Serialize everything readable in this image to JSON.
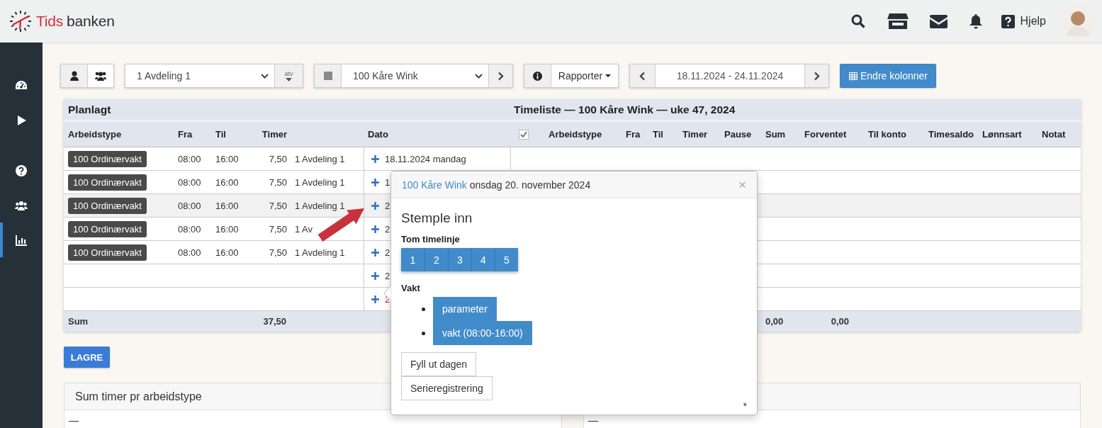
{
  "header": {
    "logo": {
      "brand_red": "Tids",
      "brand_dark": "banken"
    },
    "help": "Hjelp"
  },
  "sidebar": {
    "items": [
      {
        "selected": false
      },
      {
        "selected": false
      },
      {
        "selected": false
      },
      {
        "selected": false
      },
      {
        "selected": true
      }
    ]
  },
  "toolbar": {
    "view_toggle": [
      {
        "selected": true
      },
      {
        "selected": false
      }
    ],
    "department": {
      "value": "1 Avdeling 1"
    },
    "atv": "atv",
    "employee": {
      "value": "100 Kåre Wink"
    },
    "reports": "Rapporter",
    "date_range": "18.11.2024 - 24.11.2024",
    "columns_button": "Endre kolonner"
  },
  "table": {
    "planned_title": "Planlagt",
    "timesheet_title": "Timeliste — 100 Kåre Wink — uke 47, 2024",
    "planned_columns": [
      "Arbeidstype",
      "Fra",
      "Til",
      "Timer"
    ],
    "date_column": "Dato",
    "timesheet_select_all": {
      "checked": true
    },
    "timesheet_columns": [
      "Arbeidstype",
      "Fra",
      "Til",
      "Timer",
      "Pause",
      "Sum",
      "Forventet",
      "Til konto",
      "Timesaldo",
      "Lønnsart",
      "Notat"
    ],
    "rows": [
      {
        "arbeidstype": "100 Ordinærvakt",
        "fra": "08:00",
        "til": "16:00",
        "timer": "7,50",
        "avdeling": "1 Avdeling 1",
        "dato": "18.11.2024 mandag",
        "highlighted": false,
        "weekend": false
      },
      {
        "arbeidstype": "100 Ordinærvakt",
        "fra": "08:00",
        "til": "16:00",
        "timer": "7,50",
        "avdeling": "1 Avdeling 1",
        "dato": "1",
        "highlighted": false,
        "weekend": false
      },
      {
        "arbeidstype": "100 Ordinærvakt",
        "fra": "08:00",
        "til": "16:00",
        "timer": "7,50",
        "avdeling": "1 Avdeling 1",
        "dato": "2",
        "highlighted": true,
        "weekend": false
      },
      {
        "arbeidstype": "100 Ordinærvakt",
        "fra": "08:00",
        "til": "16:00",
        "timer": "7,50",
        "avdeling": "1 Av",
        "dato": "2",
        "highlighted": false,
        "weekend": false
      },
      {
        "arbeidstype": "100 Ordinærvakt",
        "fra": "08:00",
        "til": "16:00",
        "timer": "7,50",
        "avdeling": "1 Avdeling 1",
        "dato": "2",
        "highlighted": false,
        "weekend": false
      },
      {
        "dato": "2",
        "highlighted": false,
        "weekend": false
      },
      {
        "dato": "2",
        "highlighted": false,
        "weekend": true
      }
    ],
    "sum": {
      "label": "Sum",
      "timer": "37,50",
      "sum": "0,00",
      "forventet": "0,00"
    }
  },
  "save_button": "LAGRE",
  "panels": [
    {
      "title": "Sum timer pr arbeidstype",
      "body": "—"
    },
    {
      "body": "—"
    }
  ],
  "popover": {
    "employee_link": "100 Kåre Wink",
    "date": "onsdag 20. november 2024",
    "close": "×",
    "heading": "Stemple inn",
    "blank_label": "Tom timelinje",
    "blank_buttons": [
      "1",
      "2",
      "3",
      "4",
      "5"
    ],
    "shift_label": "Vakt",
    "shift_buttons": [
      "parameter",
      "vakt (08:00-16:00)"
    ],
    "actions": [
      "Fyll ut dagen",
      "Serieregistrering"
    ],
    "footnote": "*"
  }
}
